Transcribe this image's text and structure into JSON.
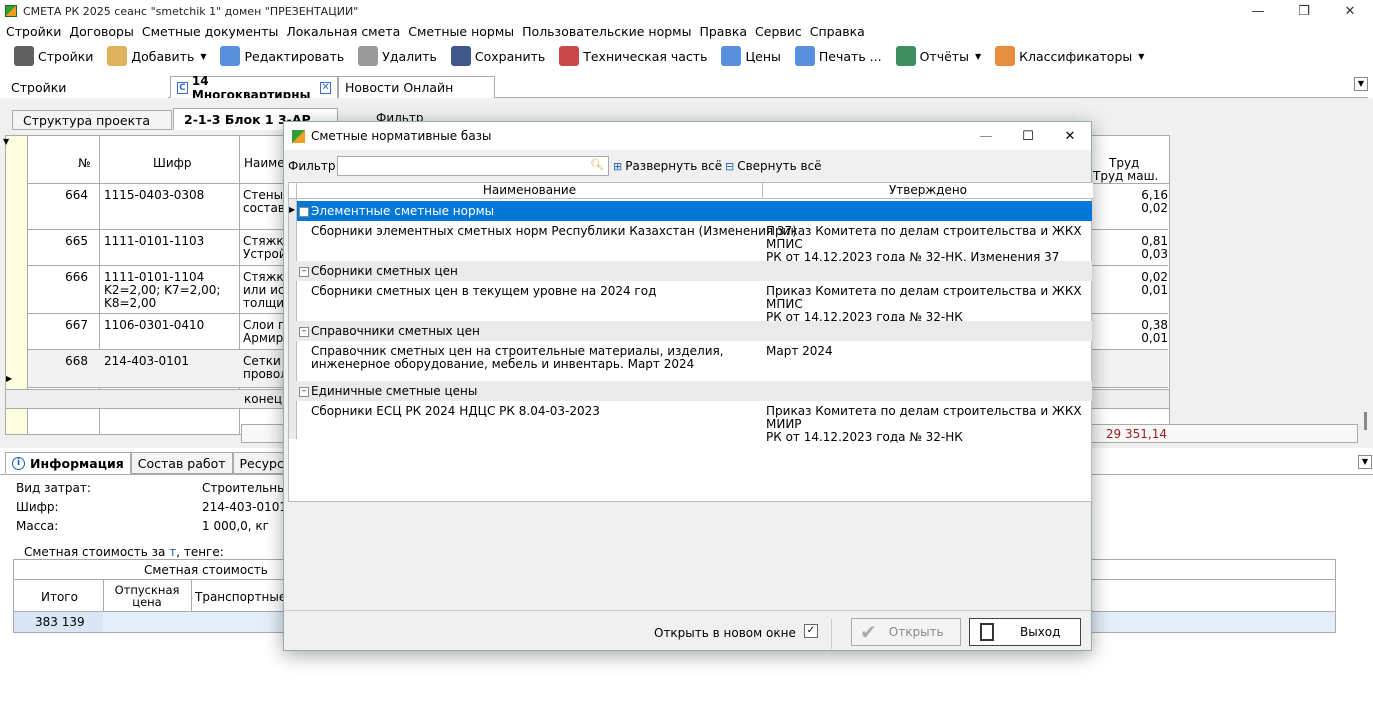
{
  "window": {
    "title": "СМЕТА РК 2025    сеанс \"smetchik 1\"  домен \"ПРЕЗЕНТАЦИИ\""
  },
  "menu": [
    "Стройки",
    "Договоры",
    "Сметные документы",
    "Локальная смета",
    "Сметные нормы",
    "Пользовательские нормы",
    "Правка",
    "Сервис",
    "Справка"
  ],
  "toolbar": [
    {
      "label": "Стройки",
      "icon": "crane-icon",
      "color": "#444444",
      "dd": false
    },
    {
      "label": "Добавить",
      "icon": "add-doc-icon",
      "color": "#d9a441",
      "dd": true
    },
    {
      "label": "Редактировать",
      "icon": "pencil-icon",
      "color": "#3a7bd5",
      "dd": false
    },
    {
      "label": "Удалить",
      "icon": "trash-icon",
      "color": "#888888",
      "dd": false
    },
    {
      "label": "Сохранить",
      "icon": "floppy-icon",
      "color": "#1f3a78",
      "dd": false
    },
    {
      "label": "Техническая часть",
      "icon": "tech-part-icon",
      "color": "#c0282d",
      "dd": false
    },
    {
      "label": "Цены",
      "icon": "bar-chart-icon",
      "color": "#3a7bd5",
      "dd": false
    },
    {
      "label": "Печать ...",
      "icon": "printer-icon",
      "color": "#3a7bd5",
      "dd": false
    },
    {
      "label": "Отчёты",
      "icon": "excel-icon",
      "color": "#1d7a43",
      "dd": true
    },
    {
      "label": "Классификаторы",
      "icon": "pie-icon",
      "color": "#e07a1f",
      "dd": true
    }
  ],
  "main_tabs": [
    "Стройки",
    "14 Многоквартирны",
    "Новости Онлайн"
  ],
  "sub_tabs": [
    "Структура проекта",
    "2-1-3 Блок 1 3-АР"
  ],
  "filter_label": "Фильтр",
  "grid": {
    "headers": {
      "num": "№",
      "code": "Шифр",
      "name": "Наимен",
      "labor1": "Труд",
      "labor2": "Труд маш."
    },
    "rows": [
      {
        "num": "664",
        "code": "1115-0403-0308",
        "name": "Стены,\nсостав",
        "l1": "6,16",
        "l2": "0,02"
      },
      {
        "num": "665",
        "code": "1111-0101-1103",
        "name": "Стяжк\nУстрой",
        "l1": "0,81",
        "l2": "0,03"
      },
      {
        "num": "666",
        "code": "1111-0101-1104\nK2=2,00; K7=2,00;\nK8=2,00",
        "name": "Стяжк\nили иск\nтолщин",
        "l1": "0,02",
        "l2": "0,01"
      },
      {
        "num": "667",
        "code": "1106-0301-0410",
        "name": "Слои п\nАрмиро",
        "l1": "0,38",
        "l2": "0,01"
      },
      {
        "num": "668",
        "code": "214-403-0101",
        "name": "Сетки\nпровол",
        "l1": "",
        "": ""
      }
    ],
    "end_label": "конец",
    "total": "29 351,14"
  },
  "info": {
    "tabs": [
      "Информация",
      "Состав работ",
      "Ресурсы"
    ],
    "fields": [
      {
        "label": "Вид затрат:",
        "value": "Строительные"
      },
      {
        "label": "Шифр:",
        "value": "214-403-0101"
      },
      {
        "label": "Масса:",
        "value": "1 000,0, кг"
      }
    ],
    "cost_caption": "Сметная стоимость за",
    "cost_unit": "т",
    "cost_tail": ", тенге:",
    "cost_header": "Сметная стоимость",
    "cost_cols": [
      "Итого",
      "Отпускная\nцена",
      "Транспортные"
    ],
    "cost_value": "383 139"
  },
  "dialog": {
    "title": "Сметные нормативные базы",
    "filter_label": "Фильтр",
    "expand_all": "Развернуть всё",
    "collapse_all": "Свернуть всё",
    "col_name": "Наименование",
    "col_approved": "Утверждено",
    "groups": [
      {
        "label": "Элементные сметные нормы",
        "name": "Сборники элементных сметных норм Республики Казахстан (Изменения 37)",
        "approved": "Приказ Комитета по делам строительства и ЖКХ МПИС\nРК от 14.12.2023 года № 32-НК, Изменения 37"
      },
      {
        "label": "Сборники сметных цен",
        "name": "Сборники сметных цен в текущем уровне на 2024 год",
        "approved": "Приказ Комитета по делам строительства и ЖКХ МПИС\nРК от 14.12.2023 года № 32-НК"
      },
      {
        "label": "Справочники сметных цен",
        "name": "Справочник сметных цен на строительные материалы, изделия,\nинженерное оборудование, мебель и инвентарь. Март 2024",
        "approved": "Март 2024"
      },
      {
        "label": "Единичные сметные цены",
        "name": "Сборники ЕСЦ РК 2024 НДЦС РК 8.04-03-2023",
        "approved": "Приказ Комитета по делам строительства и ЖКХ МИИР\nРК от 14.12.2023 года № 32-НК"
      }
    ],
    "open_new_window": "Открыть в новом окне",
    "open_btn": "Открыть",
    "exit_btn": "Выход"
  },
  "colors": {
    "selection": "#0078d7",
    "total": "#9b1c1c",
    "grid_highlight": "#fffde0"
  }
}
